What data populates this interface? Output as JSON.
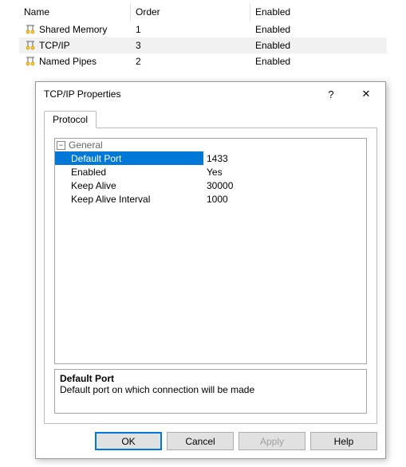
{
  "list": {
    "columns": {
      "name": "Name",
      "order": "Order",
      "enabled": "Enabled"
    },
    "rows": [
      {
        "name": "Shared Memory",
        "order": "1",
        "enabled": "Enabled",
        "selected": false
      },
      {
        "name": "TCP/IP",
        "order": "3",
        "enabled": "Enabled",
        "selected": true
      },
      {
        "name": "Named Pipes",
        "order": "2",
        "enabled": "Enabled",
        "selected": false
      }
    ]
  },
  "dialog": {
    "title": "TCP/IP Properties",
    "help_symbol": "?",
    "close_symbol": "✕",
    "tab_label": "Protocol",
    "group_label": "General",
    "group_toggle": "−",
    "properties": [
      {
        "name": "Default Port",
        "value": "1433",
        "selected": true
      },
      {
        "name": "Enabled",
        "value": "Yes",
        "selected": false
      },
      {
        "name": "Keep Alive",
        "value": "30000",
        "selected": false
      },
      {
        "name": "Keep Alive Interval",
        "value": "1000",
        "selected": false
      }
    ],
    "description": {
      "title": "Default Port",
      "text": "Default port on which connection will be made"
    },
    "buttons": {
      "ok": "OK",
      "cancel": "Cancel",
      "apply": "Apply",
      "help": "Help"
    }
  }
}
